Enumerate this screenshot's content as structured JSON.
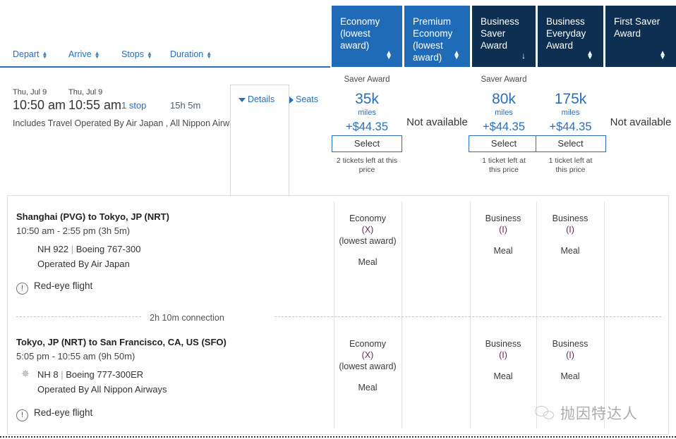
{
  "fare_header": {
    "tabs": [
      {
        "label": "Economy\n(lowest\naward)",
        "sort": "updown",
        "style": "light"
      },
      {
        "label": "Premium\nEconomy\n(lowest\naward)",
        "sort": "updown",
        "style": "light"
      },
      {
        "label": "Business\nSaver Award",
        "sort": "down",
        "style": "dark"
      },
      {
        "label": "Business\nEveryday\nAward",
        "sort": "updown",
        "style": "dark"
      },
      {
        "label": "First Saver\nAward",
        "sort": "updown",
        "style": "dark"
      }
    ],
    "colors": {
      "light": "#1f6bb8",
      "dark": "#0d2f52",
      "accent": "#2a6ebb"
    }
  },
  "sortbar": {
    "items": [
      {
        "label": "Depart"
      },
      {
        "label": "Arrive"
      },
      {
        "label": "Stops"
      },
      {
        "label": "Duration"
      }
    ]
  },
  "flight_row": {
    "depart_date": "Thu, Jul 9",
    "depart_time": "10:50 am",
    "arrive_date": "Thu, Jul 9",
    "arrive_time": "10:55 am",
    "stops": "1 stop",
    "duration": "15h 5m",
    "includes": "Includes Travel Operated By Air Japan , All Nippon Airways",
    "details_label": "Details",
    "seats_label": "Seats"
  },
  "fares": [
    {
      "award_label": "Saver Award",
      "miles": "35k",
      "miles_unit": "miles",
      "cash": "+$44.35",
      "select_label": "Select",
      "tickets_left": "2 tickets left at this price",
      "available": true
    },
    {
      "not_available": "Not available",
      "available": false
    },
    {
      "award_label": "Saver Award",
      "miles": "80k",
      "miles_unit": "miles",
      "cash": "+$44.35",
      "select_label": "Select",
      "tickets_left": "1 ticket left at this price",
      "available": true
    },
    {
      "award_label": "",
      "miles": "175k",
      "miles_unit": "miles",
      "cash": "+$44.35",
      "select_label": "Select",
      "tickets_left": "1 ticket left at this price",
      "available": true
    },
    {
      "not_available": "Not available",
      "available": false
    }
  ],
  "details_panel": {
    "segments": [
      {
        "route": "Shanghai (PVG) to Tokyo, JP (NRT)",
        "times": "10:50 am - 2:55 pm (3h 5m)",
        "flight_no": "NH 922",
        "aircraft": "Boeing 767-300",
        "operated_by": "Operated By Air Japan",
        "redeye": "Red-eye flight",
        "star": false,
        "cabins": [
          {
            "cls": "Economy",
            "code": "(X)",
            "lowest": "(lowest award)",
            "meal": "Meal"
          },
          null,
          {
            "cls": "Business",
            "code": "(I)",
            "lowest": "",
            "meal": "Meal"
          },
          {
            "cls": "Business",
            "code": "(I)",
            "lowest": "",
            "meal": "Meal"
          },
          null
        ]
      },
      {
        "route": "Tokyo, JP (NRT) to San Francisco, CA, US (SFO)",
        "times": "5:05 pm - 10:55 am (9h 50m)",
        "flight_no": "NH 8",
        "aircraft": "Boeing 777-300ER",
        "operated_by": "Operated By All Nippon Airways",
        "redeye": "Red-eye flight",
        "star": true,
        "cabins": [
          {
            "cls": "Economy",
            "code": "(X)",
            "lowest": "(lowest award)",
            "meal": "Meal"
          },
          null,
          {
            "cls": "Business",
            "code": "(I)",
            "lowest": "",
            "meal": "Meal"
          },
          {
            "cls": "Business",
            "code": "(I)",
            "lowest": "",
            "meal": "Meal"
          },
          null
        ]
      }
    ],
    "connection": "2h 10m connection"
  },
  "watermark": {
    "text": "抛因特达人"
  },
  "icons": {
    "details_caret": "caret-down-icon",
    "seats_caret": "caret-right-icon",
    "warning": "!",
    "star": "✵",
    "sort_up": "▲",
    "sort_down": "▼"
  }
}
